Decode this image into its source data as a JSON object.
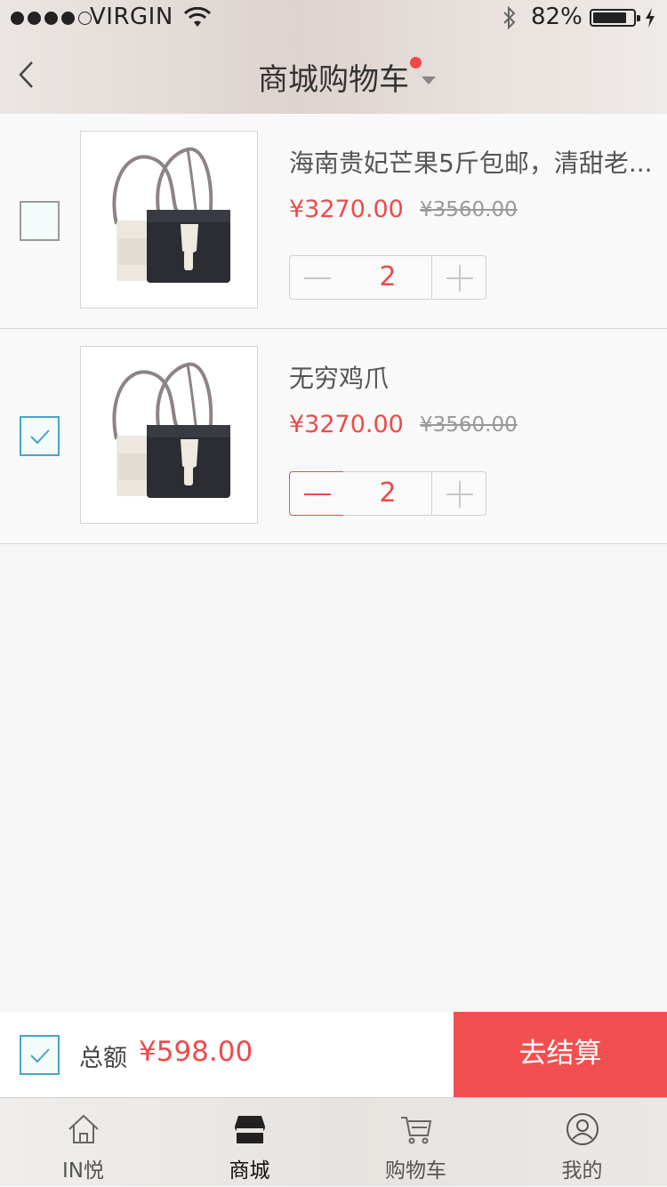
{
  "status_bar": {
    "carrier": "VIRGIN",
    "battery": "82%"
  },
  "nav": {
    "title": "商城购物车"
  },
  "items": [
    {
      "name": "海南贵妃芒果5斤包邮，清甜老...",
      "price": "¥3270.00",
      "old_price": "¥3560.00",
      "quantity": "2",
      "checked": false
    },
    {
      "name": "无穷鸡爪",
      "price": "¥3270.00",
      "old_price": "¥3560.00",
      "quantity": "2",
      "checked": true
    }
  ],
  "footer": {
    "total_label": "总额",
    "total_amount": "¥598.00",
    "checkout_label": "去结算",
    "select_all_checked": true
  },
  "tabs": [
    {
      "label": "IN悦",
      "icon": "home-icon"
    },
    {
      "label": "商城",
      "icon": "store-icon",
      "active": true
    },
    {
      "label": "购物车",
      "icon": "cart-icon"
    },
    {
      "label": "我的",
      "icon": "profile-icon"
    }
  ],
  "colors": {
    "accent_red": "#ee4a4a",
    "checkout_bg": "#f25050",
    "checkbox_checked": "#4aa3c6"
  }
}
